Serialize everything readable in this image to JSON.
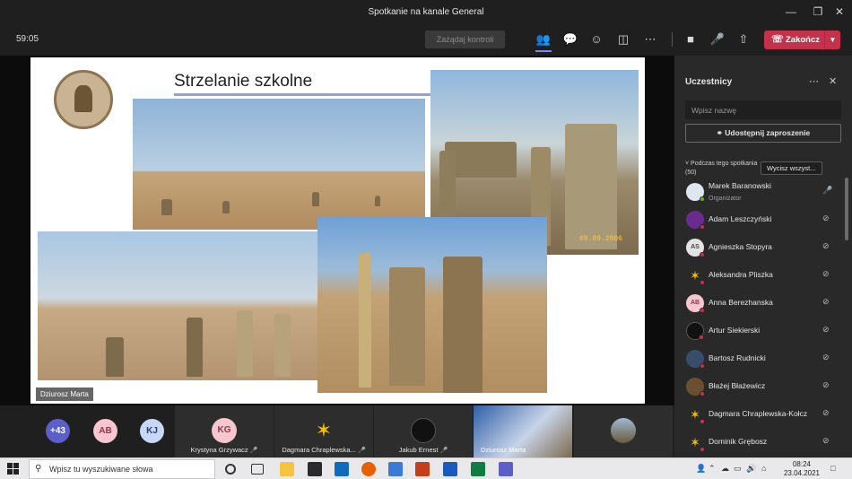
{
  "window": {
    "title": "Spotkanie na kanale General"
  },
  "toolbar": {
    "timer": "59:05",
    "request_control_label": "Zażądaj kontroli",
    "end_call_label": "Zakończ",
    "icons": [
      "participants-icon",
      "chat-icon",
      "reactions-icon",
      "share-tray-icon",
      "more-icon",
      "camera-off-icon",
      "microphone-icon",
      "share-screen-icon"
    ]
  },
  "slide": {
    "title": "Strzelanie szkolne",
    "photo_date": "09.09.2006"
  },
  "stage": {
    "presenter_name": "Dziurosz Marta"
  },
  "strip": {
    "overflow_count": "+43",
    "initials": [
      {
        "text": "AB",
        "color": "#f7c6cf"
      },
      {
        "text": "KJ",
        "color": "#c7d7f5"
      }
    ],
    "tiles": [
      {
        "name": "Krystyna Grzywacz",
        "initials": "KG"
      },
      {
        "name": "Dagmara Chraplewska...",
        "initials": ""
      },
      {
        "name": "Jakub Ernest",
        "initials": ""
      },
      {
        "name": "Dziurosz Marta",
        "initials": ""
      },
      {
        "name": "",
        "initials": ""
      }
    ]
  },
  "panel": {
    "title": "Uczestnicy",
    "search_placeholder": "Wpisz nazwę",
    "share_invite_label": "Udostępnij zaproszenie",
    "section_label": "Podczas tego spotkania",
    "section_count": "(50)",
    "mute_all_label": "Wycisz wszyst...",
    "participants": [
      {
        "name": "Marek Baranowski",
        "role": "Organizator",
        "avatar": "",
        "color": "#dfe6f0",
        "mic": "on"
      },
      {
        "name": "Adam Leszczyński",
        "role": "",
        "avatar": "",
        "color": "#6a2c8c",
        "mic": "off"
      },
      {
        "name": "Agnieszka Stopyra",
        "role": "",
        "avatar": "AS",
        "color": "#e3e3e3",
        "mic": "off"
      },
      {
        "name": "Aleksandra Pliszka",
        "role": "",
        "avatar": "star",
        "color": "#292929",
        "mic": "off"
      },
      {
        "name": "Anna Berezhanska",
        "role": "",
        "avatar": "AB",
        "color": "#f7c6cf",
        "mic": "off"
      },
      {
        "name": "Artur Siekierski",
        "role": "",
        "avatar": "",
        "color": "#111111",
        "mic": "off"
      },
      {
        "name": "Bartosz Rudnicki",
        "role": "",
        "avatar": "",
        "color": "#3a4c6b",
        "mic": "off"
      },
      {
        "name": "Błażej Błażewicz",
        "role": "",
        "avatar": "",
        "color": "#6b4f2f",
        "mic": "off"
      },
      {
        "name": "Dagmara Chraplewska-Kołcz",
        "role": "",
        "avatar": "star",
        "color": "#292929",
        "mic": "off"
      },
      {
        "name": "Dominik Grębosz",
        "role": "",
        "avatar": "star",
        "color": "#292929",
        "mic": "off"
      }
    ]
  },
  "taskbar": {
    "search_placeholder": "Wpisz tu wyszukiwane słowa",
    "time": "08:24",
    "date": "23.04.2021"
  }
}
